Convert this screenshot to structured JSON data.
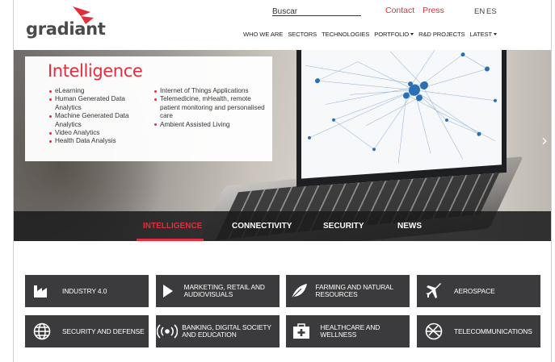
{
  "header": {
    "logo_text": "gradiant",
    "search_placeholder": "Buscar",
    "contact": "Contact",
    "press": "Press",
    "lang_en": "EN",
    "lang_es": "ES",
    "nav": [
      {
        "label": "WHO WE ARE"
      },
      {
        "label": "SECTORS"
      },
      {
        "label": "TECHNOLOGIES"
      },
      {
        "label": "PORTFOLIO",
        "dropdown": true
      },
      {
        "label": "R&D PROJECTS"
      },
      {
        "label": "LATEST",
        "dropdown": true
      }
    ]
  },
  "hero": {
    "title": "Intelligence",
    "col1": [
      "eLearning",
      "Human Generated Data Analytics",
      "Machine Generated Data Analytics",
      "Video Analytics",
      "Health Data Analysis"
    ],
    "col2": [
      "Internet of Things Applications",
      "Telemedicine, mHealth, remote patient monitoring and personalised care",
      "Ambient Assisted Living"
    ],
    "next_arrow": "›"
  },
  "tabs": [
    {
      "label": "INTELLIGENCE",
      "active": true
    },
    {
      "label": "CONNECTIVITY",
      "active": false
    },
    {
      "label": "SECURITY",
      "active": false
    },
    {
      "label": "NEWS",
      "active": false
    }
  ],
  "sectors": [
    {
      "label": "INDUSTRY 4.0",
      "icon": "factory-icon"
    },
    {
      "label": "MARKETING, RETAIL AND AUDIOVISUALS",
      "icon": "play-icon"
    },
    {
      "label": "FARMING AND NATURAL RESOURCES",
      "icon": "leaf-icon"
    },
    {
      "label": "AEROSPACE",
      "icon": "airplane-icon"
    },
    {
      "label": "SECURITY AND DEFENSE",
      "icon": "globe-icon"
    },
    {
      "label": "BANKING, DIGITAL SOCIETY AND EDUCATION",
      "icon": "broadcast-icon"
    },
    {
      "label": "HEALTHCARE AND WELLNESS",
      "icon": "medkit-icon"
    },
    {
      "label": "TELECOMMUNICATIONS",
      "icon": "satellite-icon"
    }
  ],
  "colors": {
    "accent": "#e32d3c",
    "tile": "#3b3b3d",
    "tabbar": "#1c1c1e"
  }
}
